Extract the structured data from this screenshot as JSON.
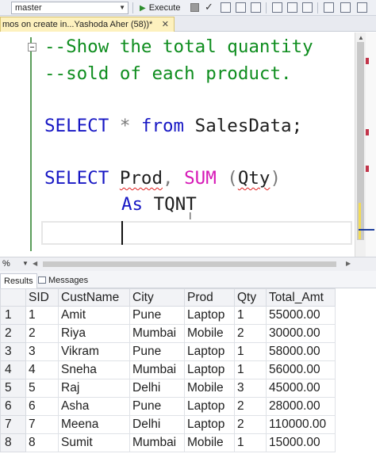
{
  "toolbar": {
    "database": "master",
    "execute_label": "Execute"
  },
  "tab": {
    "title": "mos on create in...Yashoda Aher (58))*",
    "close": "✕"
  },
  "editor": {
    "comment_line1": "--Show the total quantity",
    "comment_line2": "--sold of each product.",
    "select_kw": "SELECT",
    "star": "*",
    "from_kw": "from",
    "table_name": "SalesData;",
    "prod": "Prod",
    "comma": ",",
    "sum_fn": "SUM",
    "paren_open": "(",
    "qty": "Qty",
    "paren_close": ")",
    "as_kw": "As",
    "alias": "TQNT"
  },
  "zoom": {
    "label": "%"
  },
  "results_tabs": {
    "results": "Results",
    "messages": "Messages"
  },
  "grid": {
    "columns": [
      "SID",
      "CustName",
      "City",
      "Prod",
      "Qty",
      "Total_Amt"
    ],
    "rows": [
      [
        "1",
        "Amit",
        "Pune",
        "Laptop",
        "1",
        "55000.00"
      ],
      [
        "2",
        "Riya",
        "Mumbai",
        "Mobile",
        "2",
        "30000.00"
      ],
      [
        "3",
        "Vikram",
        "Pune",
        "Laptop",
        "1",
        "58000.00"
      ],
      [
        "4",
        "Sneha",
        "Mumbai",
        "Laptop",
        "1",
        "56000.00"
      ],
      [
        "5",
        "Raj",
        "Delhi",
        "Mobile",
        "3",
        "45000.00"
      ],
      [
        "6",
        "Asha",
        "Pune",
        "Laptop",
        "2",
        "28000.00"
      ],
      [
        "7",
        "Meena",
        "Delhi",
        "Laptop",
        "2",
        "110000.00"
      ],
      [
        "8",
        "Sumit",
        "Mumbai",
        "Mobile",
        "1",
        "15000.00"
      ]
    ],
    "row_numbers": [
      "1",
      "2",
      "3",
      "4",
      "5",
      "6",
      "7",
      "8"
    ]
  },
  "colors": {
    "comment": "#0e8d1e",
    "keyword": "#1717c4",
    "function": "#d617b6",
    "tab_active": "#fdf1be"
  }
}
